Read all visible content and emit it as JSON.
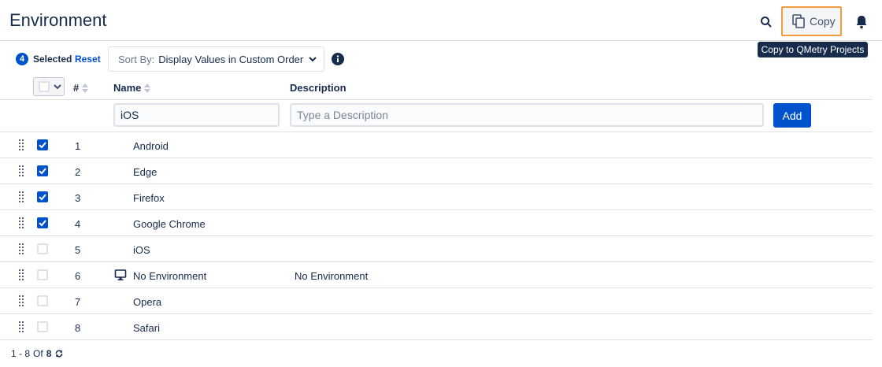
{
  "header": {
    "title": "Environment",
    "copy_label": "Copy",
    "tooltip": "Copy to QMetry Projects",
    "icons": {
      "search": "search-icon",
      "copy": "copy-icon",
      "bell": "bell-icon"
    },
    "highlight_color": "#f29b3a"
  },
  "toolbar": {
    "selected_count": "4",
    "selected_label": "Selected",
    "reset_label": "Reset",
    "sort_prefix": "Sort By:",
    "sort_value": "Display Values in Custom Order"
  },
  "columns": {
    "number": "#",
    "name": "Name",
    "description": "Description"
  },
  "filter": {
    "name_value": "iOS",
    "description_placeholder": "Type a Description",
    "add_label": "Add"
  },
  "rows": [
    {
      "num": "1",
      "name": "Android",
      "description": "",
      "checked": true,
      "icon": ""
    },
    {
      "num": "2",
      "name": "Edge",
      "description": "",
      "checked": true,
      "icon": ""
    },
    {
      "num": "3",
      "name": "Firefox",
      "description": "",
      "checked": true,
      "icon": ""
    },
    {
      "num": "4",
      "name": "Google Chrome",
      "description": "",
      "checked": true,
      "icon": ""
    },
    {
      "num": "5",
      "name": "iOS",
      "description": "",
      "checked": false,
      "icon": ""
    },
    {
      "num": "6",
      "name": "No Environment",
      "description": "No Environment",
      "checked": false,
      "icon": "monitor-icon"
    },
    {
      "num": "7",
      "name": "Opera",
      "description": "",
      "checked": false,
      "icon": ""
    },
    {
      "num": "8",
      "name": "Safari",
      "description": "",
      "checked": false,
      "icon": ""
    }
  ],
  "footer": {
    "range": "1 - 8",
    "of_label": "Of",
    "total": "8"
  },
  "colors": {
    "primary": "#0052cc",
    "text": "#172b4d",
    "border": "#dfe1e6"
  }
}
